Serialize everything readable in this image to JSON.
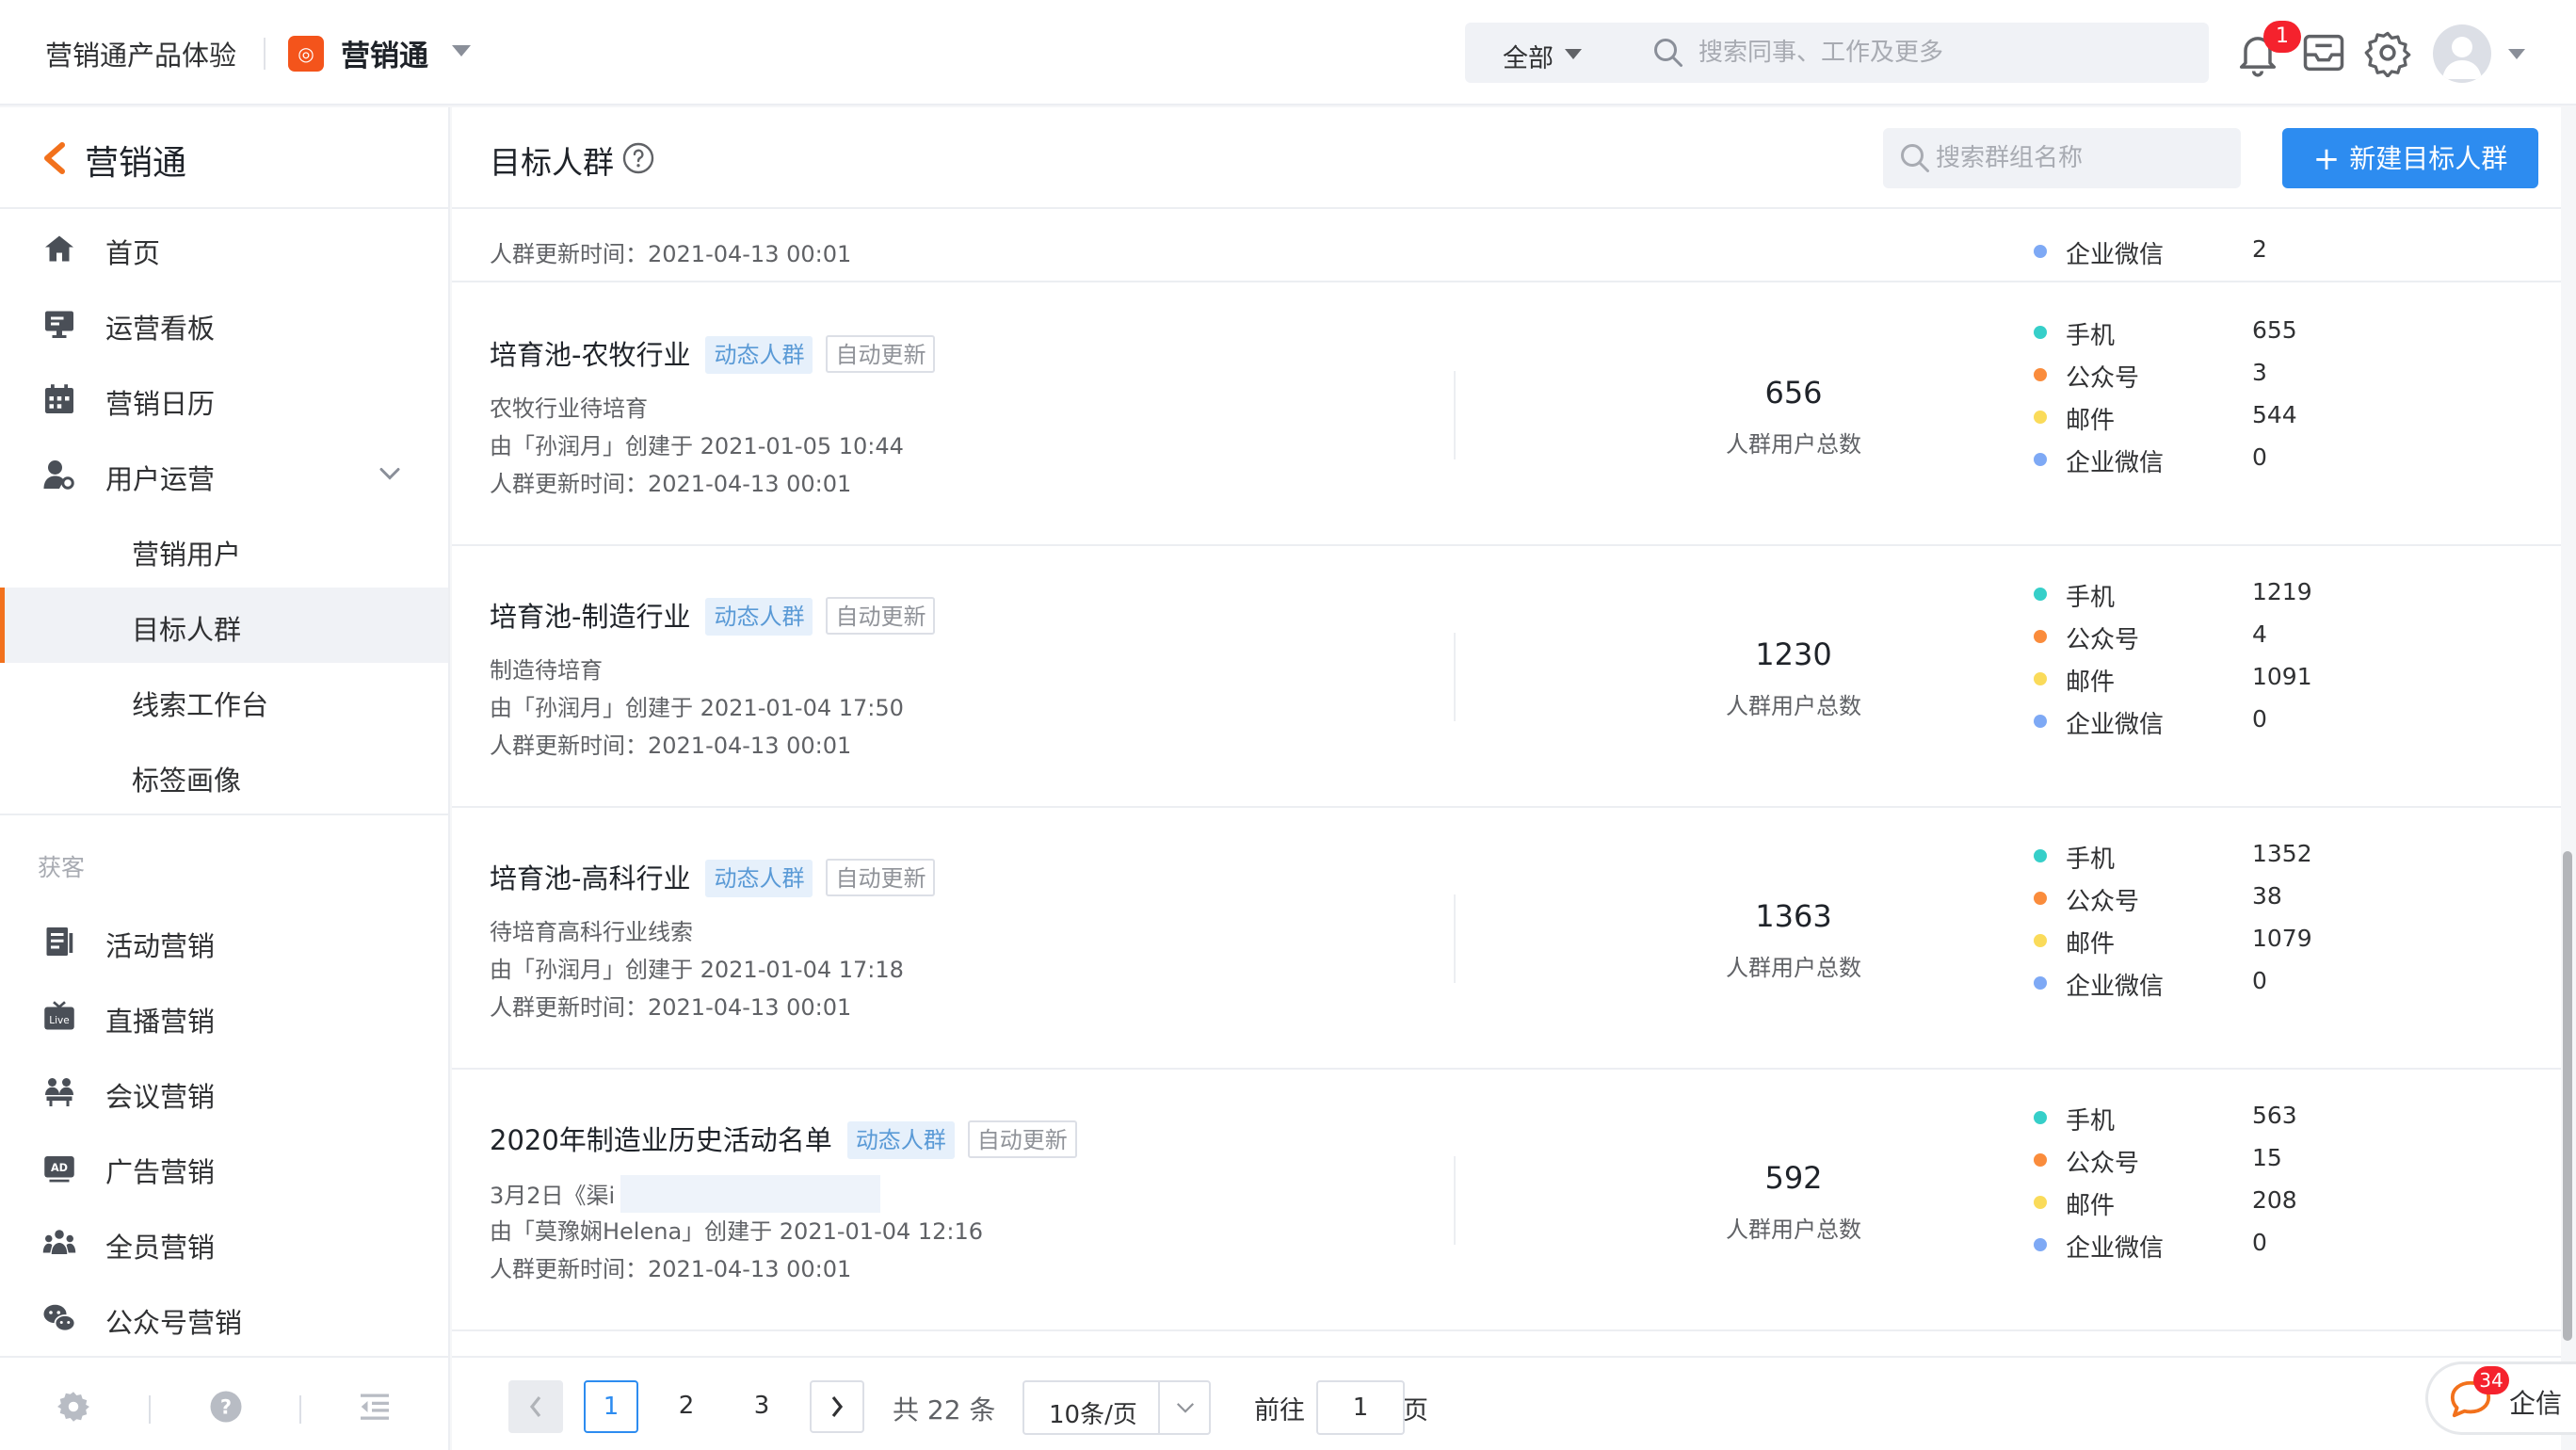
{
  "topbar": {
    "brand_text": "营销通产品体验",
    "app_name": "营销通",
    "scope": "全部",
    "search_placeholder": "搜索同事、工作及更多",
    "notification_count": "1"
  },
  "sidebar": {
    "title": "营销通",
    "items": [
      {
        "label": "首页",
        "icon": "home-icon"
      },
      {
        "label": "运营看板",
        "icon": "dashboard-icon"
      },
      {
        "label": "营销日历",
        "icon": "calendar-icon"
      },
      {
        "label": "用户运营",
        "icon": "user-ops-icon"
      }
    ],
    "sub_items": [
      {
        "label": "营销用户"
      },
      {
        "label": "目标人群"
      },
      {
        "label": "线索工作台"
      },
      {
        "label": "标签画像"
      }
    ],
    "section_label": "获客",
    "acquire_items": [
      {
        "label": "活动营销",
        "icon": "activity-icon"
      },
      {
        "label": "直播营销",
        "icon": "live-icon"
      },
      {
        "label": "会议营销",
        "icon": "meeting-icon"
      },
      {
        "label": "广告营销",
        "icon": "ad-icon"
      },
      {
        "label": "全员营销",
        "icon": "team-icon"
      },
      {
        "label": "公众号营销",
        "icon": "wechat-icon"
      }
    ]
  },
  "main": {
    "title": "目标人群",
    "group_search_placeholder": "搜索群组名称",
    "new_button_label": "新建目标人群",
    "count_label": "人群用户总数",
    "channel_labels": [
      "手机",
      "公众号",
      "邮件",
      "企业微信"
    ],
    "channel_colors": [
      "#36cfc9",
      "#fa8c3c",
      "#fadb5a",
      "#7ea9f5"
    ],
    "partial_card": {
      "updated": "人群更新时间：2021-04-13 00:01",
      "last_channel_label": "企业微信",
      "last_channel_value": "2"
    },
    "cards": [
      {
        "name": "培育池-农牧行业",
        "tag_dynamic": "动态人群",
        "tag_auto": "自动更新",
        "desc": "农牧行业待培育",
        "creator": "由「孙润月」创建于 2021-01-05 10:44",
        "updated": "人群更新时间：2021-04-13 00:01",
        "total": "656",
        "channels": [
          "655",
          "3",
          "544",
          "0"
        ]
      },
      {
        "name": "培育池-制造行业",
        "tag_dynamic": "动态人群",
        "tag_auto": "自动更新",
        "desc": "制造待培育",
        "creator": "由「孙润月」创建于 2021-01-04 17:50",
        "updated": "人群更新时间：2021-04-13 00:01",
        "total": "1230",
        "channels": [
          "1219",
          "4",
          "1091",
          "0"
        ]
      },
      {
        "name": "培育池-高科行业",
        "tag_dynamic": "动态人群",
        "tag_auto": "自动更新",
        "desc": "待培育高科行业线索",
        "creator": "由「孙润月」创建于 2021-01-04 17:18",
        "updated": "人群更新时间：2021-04-13 00:01",
        "total": "1363",
        "channels": [
          "1352",
          "38",
          "1079",
          "0"
        ]
      },
      {
        "name": "2020年制造业历史活动名单",
        "tag_dynamic": "动态人群",
        "tag_auto": "自动更新",
        "desc": "3月2日《渠i",
        "creator": "由「莫豫娴Helena」创建于 2021-01-04 12:16",
        "updated": "人群更新时间：2021-04-13 00:01",
        "total": "592",
        "channels": [
          "563",
          "15",
          "208",
          "0"
        ]
      }
    ]
  },
  "pagination": {
    "pages": [
      "1",
      "2",
      "3"
    ],
    "current": "1",
    "total_text": "共 22 条",
    "page_size": "10条/页",
    "goto_label": "前往",
    "goto_value": "1",
    "page_suffix": "页"
  },
  "qixin": {
    "badge": "34",
    "label": "企信"
  }
}
